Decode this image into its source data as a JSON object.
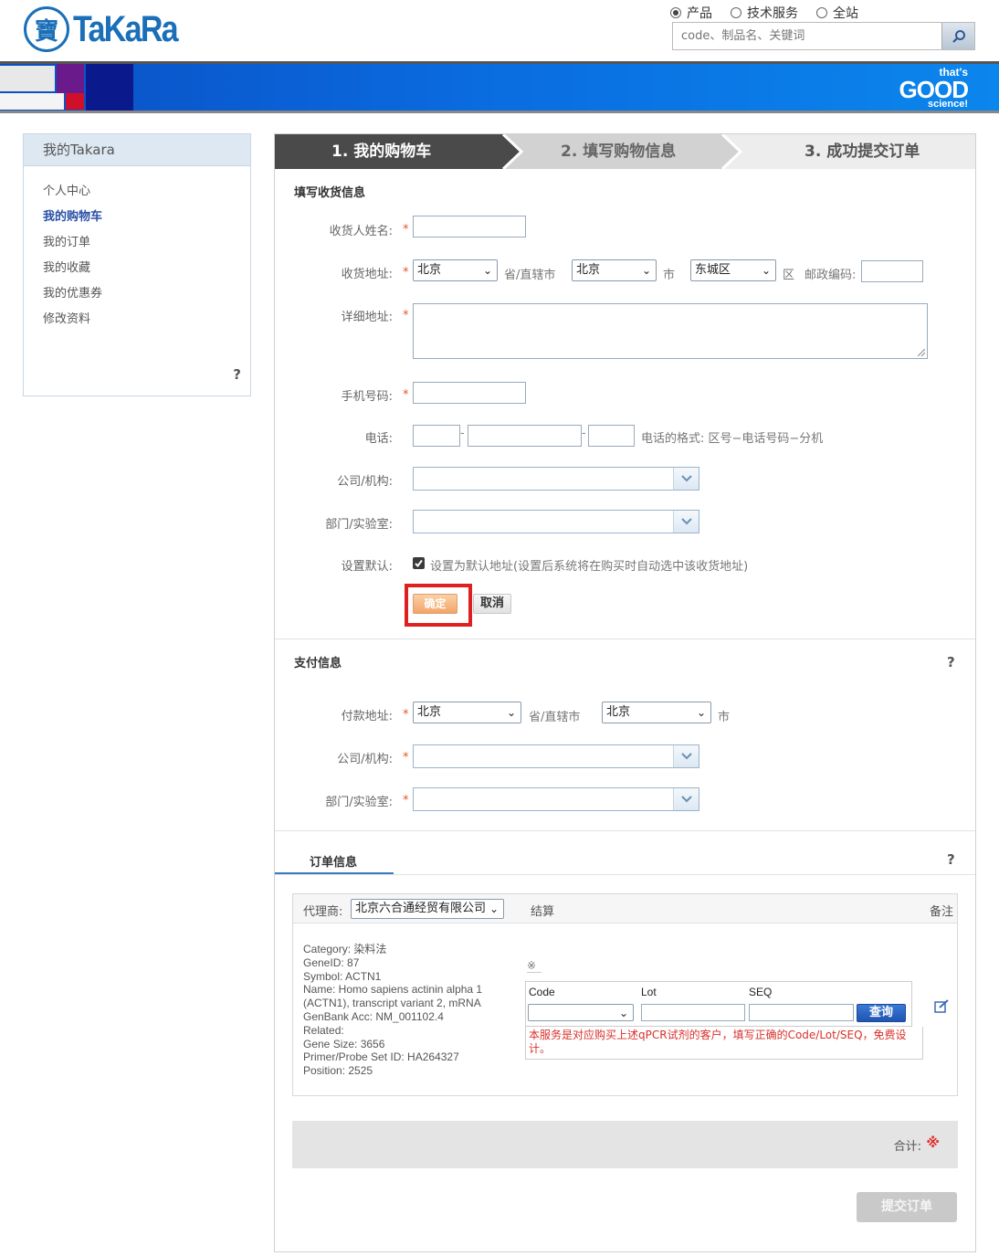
{
  "header": {
    "logo_seal": "寶",
    "logo_text": "TaKaRa",
    "search_scopes": [
      {
        "label": "产品",
        "selected": true
      },
      {
        "label": "技术服务",
        "selected": false
      },
      {
        "label": "全站",
        "selected": false
      }
    ],
    "search_placeholder": "code、制品名、关键词",
    "banner_line1": "that's",
    "banner_line2": "GOOD",
    "banner_line3": "science!"
  },
  "sidebar": {
    "title": "我的Takara",
    "items": [
      {
        "label": "个人中心",
        "active": false
      },
      {
        "label": "我的购物车",
        "active": true
      },
      {
        "label": "我的订单",
        "active": false
      },
      {
        "label": "我的收藏",
        "active": false
      },
      {
        "label": "我的优惠券",
        "active": false
      },
      {
        "label": "修改资料",
        "active": false
      }
    ],
    "help": "?"
  },
  "steps": [
    {
      "label": "1. 我的购物车",
      "state": "current"
    },
    {
      "label": "2. 填写购物信息",
      "state": "next"
    },
    {
      "label": "3. 成功提交订单",
      "state": "next"
    }
  ],
  "shipping": {
    "title": "填写收货信息",
    "name_label": "收货人姓名:",
    "address_label": "收货地址:",
    "province": "北京",
    "province_suffix": "省/直辖市",
    "city": "北京",
    "city_suffix": "市",
    "district": "东城区",
    "district_suffix": "区",
    "zip_label": "邮政编码:",
    "detail_label": "详细地址:",
    "mobile_label": "手机号码:",
    "phone_label": "电话:",
    "phone_hint": "电话的格式: 区号−电话号码−分机",
    "company_label": "公司/机构:",
    "dept_label": "部门/实验室:",
    "default_label": "设置默认:",
    "default_checkbox": "设置为默认地址(设置后系统将在购买时自动选中该收货地址)",
    "default_checked": true,
    "confirm_button": "确定",
    "cancel_button": "取消",
    "required_mark": "*"
  },
  "payment": {
    "title": "支付信息",
    "address_label": "付款地址:",
    "province": "北京",
    "province_suffix": "省/直辖市",
    "city": "北京",
    "city_suffix": "市",
    "company_label": "公司/机构:",
    "dept_label": "部门/实验室:",
    "help": "?"
  },
  "order": {
    "tab_title": "订单信息",
    "help": "?",
    "agent_label": "代理商:",
    "agent_value": "北京六合通经贸有限公司",
    "settle_label": "结算",
    "remark_label": "备注",
    "product_lines": [
      "Category: 染料法",
      "GeneID: 87",
      "Symbol: ACTN1",
      "Name: Homo sapiens actinin alpha 1",
      "(ACTN1), transcript variant 2, mRNA",
      "GenBank Acc: NM_001102.4",
      "Related:",
      "Gene Size: 3656",
      "Primer/Probe Set ID: HA264327",
      "Position: 2525"
    ],
    "note_mark": "※",
    "col_code": "Code",
    "col_lot": "Lot",
    "col_seq": "SEQ",
    "query_button": "查询",
    "service_note": "本服务是对应购买上述qPCR试剂的客户，填写正确的Code/Lot/SEQ，免费设计。",
    "total_label": "合计:",
    "total_value": "※",
    "submit_button": "提交订单"
  },
  "colors": {
    "accent_blue": "#1a6fb8",
    "required": "#e05a2a",
    "highlight_box": "#e02020",
    "confirm_orange": "#f7b27a"
  }
}
